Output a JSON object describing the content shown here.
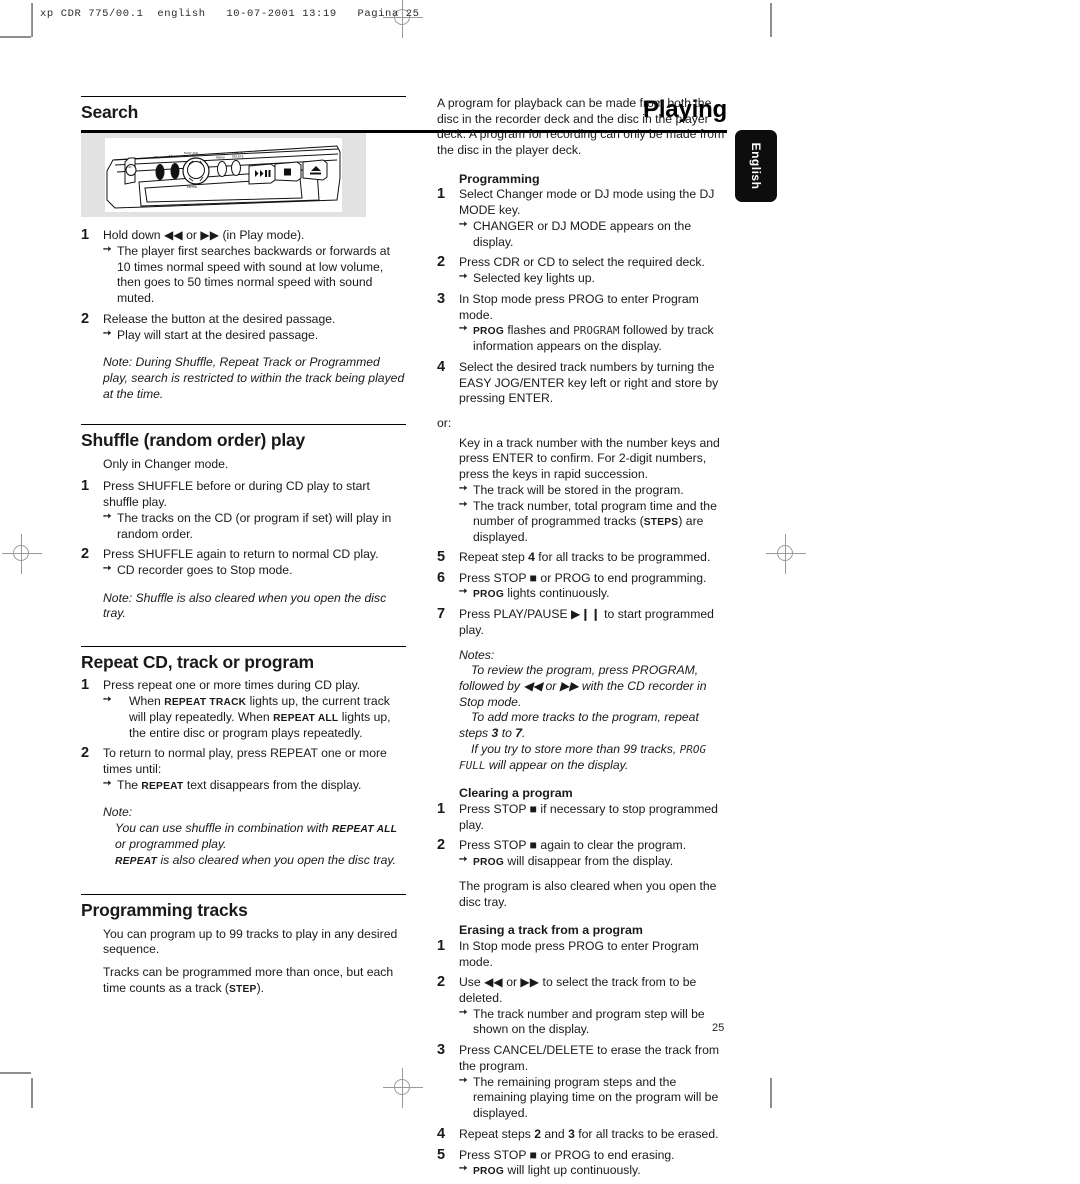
{
  "printer_slug": "xp CDR 775/00.1  english   10-07-2001 13:19   Pagina 25",
  "running_head": "Playing",
  "language_tab": "English",
  "page_number": "25",
  "left_column": {
    "search": {
      "heading": "Search",
      "figure_caption": "",
      "steps": [
        {
          "num": "1",
          "text_before": "Hold down ",
          "icon_a": "rewind-icon",
          "mid": " or ",
          "icon_b": "forward-icon",
          "text_after": " (in Play mode).",
          "arrows": [
            "The player first searches backwards or forwards at 10 times normal speed  with sound at low volume, then goes to 50 times normal speed with sound muted."
          ]
        },
        {
          "num": "2",
          "text_before": "Release the button at the desired passage.",
          "arrows": [
            "Play will start at the desired passage."
          ]
        }
      ],
      "note": "Note: During Shuffle, Repeat Track or Programmed play, search is restricted to within the track being played at the time."
    },
    "shuffle": {
      "heading": "Shuffle (random order) play",
      "intro": "Only in Changer mode.",
      "steps": [
        {
          "num": "1",
          "text": "Press SHUFFLE before or during CD play to start shuffle play.",
          "arrows": [
            "The tracks on the CD (or program if set) will play in random order."
          ]
        },
        {
          "num": "2",
          "text": "Press SHUFFLE again to return to normal CD play.",
          "arrows": [
            "CD recorder goes to Stop mode."
          ]
        }
      ],
      "note": "Note: Shuffle is also cleared when you open the disc tray."
    },
    "repeat": {
      "heading": "Repeat CD, track or program",
      "step1_num": "1",
      "step1_text": "Press repeat one or more times during CD play.",
      "step1_arrow_a": "When ",
      "step1_label_a": "REPEAT TRACK",
      "step1_arrow_b": " lights up, the current track will play repeatedly. When ",
      "step1_label_b": "REPEAT ALL",
      "step1_arrow_c": " lights up, the entire disc or program plays repeatedly.",
      "step2_num": "2",
      "step2_text": "To return to normal play, press REPEAT one or more times until:",
      "step2_arrow_a": "The ",
      "step2_label": "REPEAT",
      "step2_arrow_b": " text disappears from the display.",
      "note_label": "Note:",
      "note_a": "You can use shuffle in combination with ",
      "note_label_a": "REPEAT ALL",
      "note_b": " or programmed play.",
      "note_label_b": "REPEAT",
      "note_c": " is also cleared when you open the disc tray."
    },
    "programming_tracks": {
      "heading": "Programming tracks",
      "para1": "You can program up to 99 tracks to play in any desired sequence.",
      "para2_a": "Tracks can be programmed more than once, but each time counts as a track (",
      "para2_label": "STEP",
      "para2_b": ")."
    }
  },
  "right_column": {
    "intro": "A program for playback can be made from both the disc in the recorder deck and the disc in the player deck. A program for recording can only be made from the disc in the player deck.",
    "programming": {
      "heading": "Programming",
      "s1_num": "1",
      "s1_text": "Select Changer mode or DJ mode using the DJ MODE key.",
      "s1_arrow": "CHANGER or DJ MODE appears on the display.",
      "s2_num": "2",
      "s2_text": "Press CDR or CD to select the required deck.",
      "s2_arrow": "Selected key lights up.",
      "s3_num": "3",
      "s3_text": "In Stop mode press PROG to enter Program mode.",
      "s3_arrow_a": "PROG",
      "s3_arrow_b": " flashes and ",
      "s3_lcd": "PROGRAM",
      "s3_arrow_c": " followed by track information appears on the display.",
      "s4_num": "4",
      "s4_text": "Select the desired track numbers by turning the EASY JOG/ENTER key left or right and store by pressing ENTER.",
      "or_label": "or:",
      "or_text": "Key in a track number with the number keys and press ENTER to confirm. For 2-digit numbers, press the keys in rapid succession.",
      "or_arrow_1": "The track will be stored in the program.",
      "or_arrow_2_a": "The track number, total program time and the number of programmed tracks (",
      "or_arrow_2_label": "STEPS",
      "or_arrow_2_b": ") are displayed.",
      "s5_num": "5",
      "s5_text_a": "Repeat step ",
      "s5_bold": "4",
      "s5_text_b": " for all tracks to be programmed.",
      "s6_num": "6",
      "s6_text_a": "Press STOP ",
      "s6_icon": "stop-icon",
      "s6_text_b": " or PROG to end programming.",
      "s6_arrow_label": "PROG",
      "s6_arrow_text": " lights continuously.",
      "s7_num": "7",
      "s7_text_a": "Press PLAY/PAUSE ",
      "s7_icon": "play-pause-icon",
      "s7_text_b": " to start programmed play.",
      "notes_label": "Notes:",
      "note_1": "To review the program, press PROGRAM, followed by ",
      "note_1_icon_a": "rewind-icon",
      "note_1_mid": " or ",
      "note_1_icon_b": "forward-icon",
      "note_1_end": " with the CD recorder in Stop mode.",
      "note_2_a": "To add more tracks to the program, repeat steps ",
      "note_2_b": "3",
      "note_2_c": " to ",
      "note_2_d": "7",
      "note_2_e": ".",
      "note_3_a": "If you try to store more than 99 tracks, ",
      "note_3_lcd": "PROG FULL",
      "note_3_b": " will appear on the display."
    },
    "clearing": {
      "heading": "Clearing a program",
      "s1_num": "1",
      "s1_text_a": "Press STOP ",
      "s1_icon": "stop-icon",
      "s1_text_b": " if necessary to stop programmed play.",
      "s2_num": "2",
      "s2_text_a": "Press STOP ",
      "s2_icon": "stop-icon",
      "s2_text_b": " again to clear the program.",
      "s2_arrow_label": "PROG",
      "s2_arrow_text": " will disappear from the display.",
      "closing": "The program is also cleared when you open the disc tray."
    },
    "erasing": {
      "heading": "Erasing a track from a program",
      "s1_num": "1",
      "s1_text": "In Stop mode press PROG to enter Program mode.",
      "s2_num": "2",
      "s2_text_a": "Use ",
      "s2_icon_a": "rewind-icon",
      "s2_mid": " or ",
      "s2_icon_b": "forward-icon",
      "s2_text_b": " to select the track from to be deleted.",
      "s2_arrow": "The track number and program step will be shown on the display.",
      "s3_num": "3",
      "s3_text": "Press CANCEL/DELETE to erase the track from the program.",
      "s3_arrow": "The remaining program steps and the remaining playing time on the program will be displayed.",
      "s4_num": "4",
      "s4_text_a": "Repeat steps ",
      "s4_b1": "2",
      "s4_text_b": " and ",
      "s4_b2": "3",
      "s4_text_c": " for all tracks to be erased.",
      "s5_num": "5",
      "s5_text_a": "Press STOP ",
      "s5_icon": "stop-icon",
      "s5_text_b": " or PROG to end erasing.",
      "s5_arrow_label": "PROG",
      "s5_arrow_text": " will light up continuously."
    }
  }
}
